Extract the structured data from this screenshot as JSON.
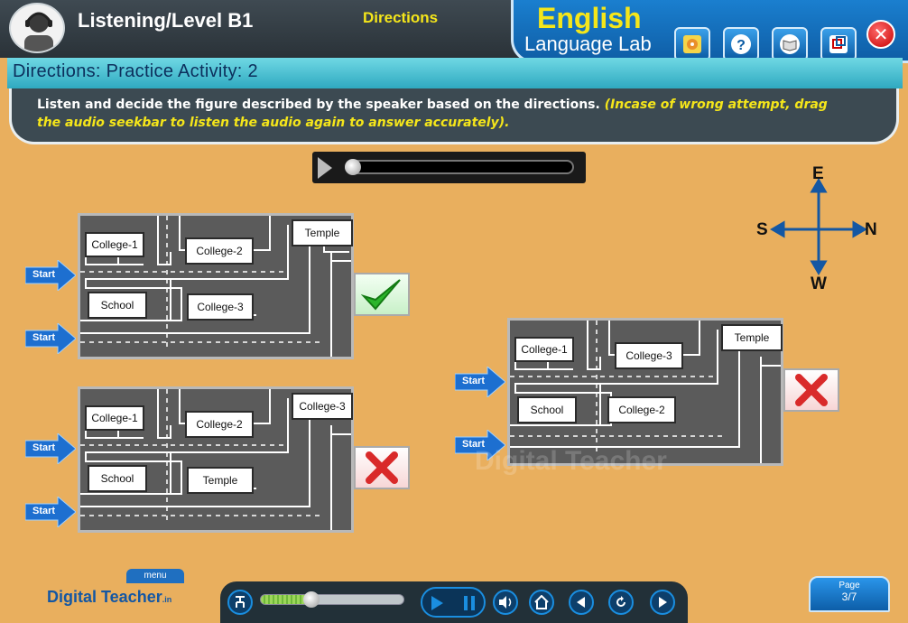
{
  "header": {
    "title": "Listening/Level B1",
    "section": "Directions",
    "brand_english": "English",
    "brand_lab": "Language Lab",
    "buttons": [
      "cd-icon",
      "help-icon",
      "book-icon",
      "window-icon"
    ]
  },
  "activity": {
    "title": "Directions: Practice Activity: 2",
    "instruction": "Listen and decide the figure described by the speaker based on the directions.",
    "note": "(Incase of wrong attempt, drag the audio seekbar to listen the audio again to answer accurately)."
  },
  "audio": {
    "progress": 0
  },
  "start_label": "Start",
  "maps": [
    {
      "id": "map-1",
      "result": "correct",
      "buildings": [
        "College-1",
        "College-2",
        "Temple",
        "School",
        "College-3"
      ]
    },
    {
      "id": "map-2",
      "result": "wrong",
      "buildings": [
        "College-1",
        "College-2",
        "College-3",
        "School",
        "Temple"
      ]
    },
    {
      "id": "map-3",
      "result": "wrong",
      "buildings": [
        "College-1",
        "College-3",
        "Temple",
        "School",
        "College-2"
      ]
    }
  ],
  "compass": {
    "north": "N",
    "south": "S",
    "east": "E",
    "west": "W"
  },
  "watermark": "Digital Teacher",
  "footer": {
    "menu": "menu",
    "logo": "Digital Teacher",
    "logo_suffix": ".in",
    "lesson_progress": 0.36,
    "page_label": "Page",
    "page_num": "3/7"
  },
  "colors": {
    "accent": "#1a7fcf",
    "brand_yellow": "#f5e61a",
    "background": "#e9af5e",
    "correct": "#2bb52b",
    "wrong": "#d92a2a"
  }
}
